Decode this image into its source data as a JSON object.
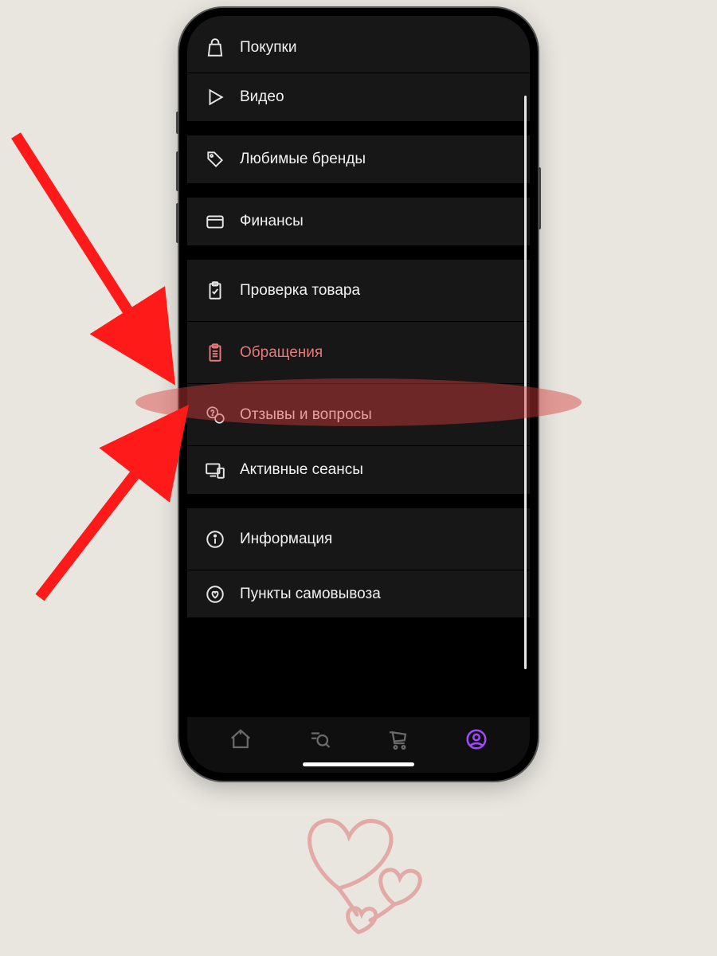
{
  "menu_items": [
    {
      "label": "Покупки",
      "icon": "bag-icon",
      "highlighted": false
    },
    {
      "label": "Видео",
      "icon": "play-icon",
      "highlighted": false,
      "group_end": true
    },
    {
      "label": "Любимые бренды",
      "icon": "tag-icon",
      "highlighted": false,
      "group_end": true
    },
    {
      "label": "Финансы",
      "icon": "card-icon",
      "highlighted": false,
      "group_end": true
    },
    {
      "label": "Проверка товара",
      "icon": "clipboard-check-icon",
      "highlighted": false
    },
    {
      "label": "Обращения",
      "icon": "clipboard-list-icon",
      "highlighted": true
    },
    {
      "label": "Отзывы и вопросы",
      "icon": "chat-question-icon",
      "highlighted": false
    },
    {
      "label": "Активные сеансы",
      "icon": "devices-icon",
      "highlighted": false,
      "group_end": true
    },
    {
      "label": "Информация",
      "icon": "info-icon",
      "highlighted": false
    },
    {
      "label": "Пункты самовывоза",
      "icon": "heart-pin-icon",
      "highlighted": false
    }
  ],
  "tabbar": {
    "active_index": 3
  },
  "colors": {
    "accent_active": "#a249ff",
    "highlight_oval": "rgba(217,59,59,0.45)",
    "arrow": "#ff1a1a",
    "heart_stroke": "#e2a9a6"
  }
}
